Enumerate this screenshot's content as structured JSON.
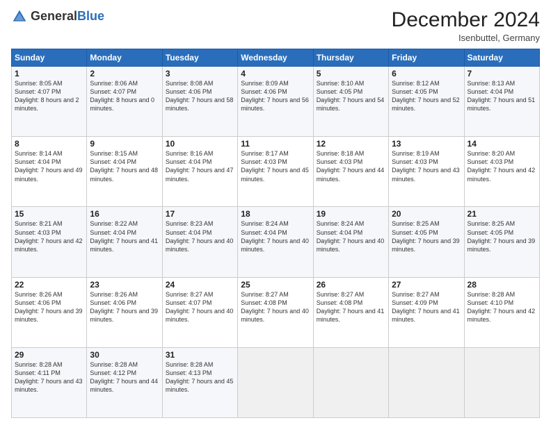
{
  "header": {
    "logo_general": "General",
    "logo_blue": "Blue",
    "title": "December 2024",
    "location": "Isenbuttel, Germany"
  },
  "weekdays": [
    "Sunday",
    "Monday",
    "Tuesday",
    "Wednesday",
    "Thursday",
    "Friday",
    "Saturday"
  ],
  "weeks": [
    [
      {
        "day": "1",
        "sunrise": "Sunrise: 8:05 AM",
        "sunset": "Sunset: 4:07 PM",
        "daylight": "Daylight: 8 hours and 2 minutes."
      },
      {
        "day": "2",
        "sunrise": "Sunrise: 8:06 AM",
        "sunset": "Sunset: 4:07 PM",
        "daylight": "Daylight: 8 hours and 0 minutes."
      },
      {
        "day": "3",
        "sunrise": "Sunrise: 8:08 AM",
        "sunset": "Sunset: 4:06 PM",
        "daylight": "Daylight: 7 hours and 58 minutes."
      },
      {
        "day": "4",
        "sunrise": "Sunrise: 8:09 AM",
        "sunset": "Sunset: 4:06 PM",
        "daylight": "Daylight: 7 hours and 56 minutes."
      },
      {
        "day": "5",
        "sunrise": "Sunrise: 8:10 AM",
        "sunset": "Sunset: 4:05 PM",
        "daylight": "Daylight: 7 hours and 54 minutes."
      },
      {
        "day": "6",
        "sunrise": "Sunrise: 8:12 AM",
        "sunset": "Sunset: 4:05 PM",
        "daylight": "Daylight: 7 hours and 52 minutes."
      },
      {
        "day": "7",
        "sunrise": "Sunrise: 8:13 AM",
        "sunset": "Sunset: 4:04 PM",
        "daylight": "Daylight: 7 hours and 51 minutes."
      }
    ],
    [
      {
        "day": "8",
        "sunrise": "Sunrise: 8:14 AM",
        "sunset": "Sunset: 4:04 PM",
        "daylight": "Daylight: 7 hours and 49 minutes."
      },
      {
        "day": "9",
        "sunrise": "Sunrise: 8:15 AM",
        "sunset": "Sunset: 4:04 PM",
        "daylight": "Daylight: 7 hours and 48 minutes."
      },
      {
        "day": "10",
        "sunrise": "Sunrise: 8:16 AM",
        "sunset": "Sunset: 4:04 PM",
        "daylight": "Daylight: 7 hours and 47 minutes."
      },
      {
        "day": "11",
        "sunrise": "Sunrise: 8:17 AM",
        "sunset": "Sunset: 4:03 PM",
        "daylight": "Daylight: 7 hours and 45 minutes."
      },
      {
        "day": "12",
        "sunrise": "Sunrise: 8:18 AM",
        "sunset": "Sunset: 4:03 PM",
        "daylight": "Daylight: 7 hours and 44 minutes."
      },
      {
        "day": "13",
        "sunrise": "Sunrise: 8:19 AM",
        "sunset": "Sunset: 4:03 PM",
        "daylight": "Daylight: 7 hours and 43 minutes."
      },
      {
        "day": "14",
        "sunrise": "Sunrise: 8:20 AM",
        "sunset": "Sunset: 4:03 PM",
        "daylight": "Daylight: 7 hours and 42 minutes."
      }
    ],
    [
      {
        "day": "15",
        "sunrise": "Sunrise: 8:21 AM",
        "sunset": "Sunset: 4:03 PM",
        "daylight": "Daylight: 7 hours and 42 minutes."
      },
      {
        "day": "16",
        "sunrise": "Sunrise: 8:22 AM",
        "sunset": "Sunset: 4:04 PM",
        "daylight": "Daylight: 7 hours and 41 minutes."
      },
      {
        "day": "17",
        "sunrise": "Sunrise: 8:23 AM",
        "sunset": "Sunset: 4:04 PM",
        "daylight": "Daylight: 7 hours and 40 minutes."
      },
      {
        "day": "18",
        "sunrise": "Sunrise: 8:24 AM",
        "sunset": "Sunset: 4:04 PM",
        "daylight": "Daylight: 7 hours and 40 minutes."
      },
      {
        "day": "19",
        "sunrise": "Sunrise: 8:24 AM",
        "sunset": "Sunset: 4:04 PM",
        "daylight": "Daylight: 7 hours and 40 minutes."
      },
      {
        "day": "20",
        "sunrise": "Sunrise: 8:25 AM",
        "sunset": "Sunset: 4:05 PM",
        "daylight": "Daylight: 7 hours and 39 minutes."
      },
      {
        "day": "21",
        "sunrise": "Sunrise: 8:25 AM",
        "sunset": "Sunset: 4:05 PM",
        "daylight": "Daylight: 7 hours and 39 minutes."
      }
    ],
    [
      {
        "day": "22",
        "sunrise": "Sunrise: 8:26 AM",
        "sunset": "Sunset: 4:06 PM",
        "daylight": "Daylight: 7 hours and 39 minutes."
      },
      {
        "day": "23",
        "sunrise": "Sunrise: 8:26 AM",
        "sunset": "Sunset: 4:06 PM",
        "daylight": "Daylight: 7 hours and 39 minutes."
      },
      {
        "day": "24",
        "sunrise": "Sunrise: 8:27 AM",
        "sunset": "Sunset: 4:07 PM",
        "daylight": "Daylight: 7 hours and 40 minutes."
      },
      {
        "day": "25",
        "sunrise": "Sunrise: 8:27 AM",
        "sunset": "Sunset: 4:08 PM",
        "daylight": "Daylight: 7 hours and 40 minutes."
      },
      {
        "day": "26",
        "sunrise": "Sunrise: 8:27 AM",
        "sunset": "Sunset: 4:08 PM",
        "daylight": "Daylight: 7 hours and 41 minutes."
      },
      {
        "day": "27",
        "sunrise": "Sunrise: 8:27 AM",
        "sunset": "Sunset: 4:09 PM",
        "daylight": "Daylight: 7 hours and 41 minutes."
      },
      {
        "day": "28",
        "sunrise": "Sunrise: 8:28 AM",
        "sunset": "Sunset: 4:10 PM",
        "daylight": "Daylight: 7 hours and 42 minutes."
      }
    ],
    [
      {
        "day": "29",
        "sunrise": "Sunrise: 8:28 AM",
        "sunset": "Sunset: 4:11 PM",
        "daylight": "Daylight: 7 hours and 43 minutes."
      },
      {
        "day": "30",
        "sunrise": "Sunrise: 8:28 AM",
        "sunset": "Sunset: 4:12 PM",
        "daylight": "Daylight: 7 hours and 44 minutes."
      },
      {
        "day": "31",
        "sunrise": "Sunrise: 8:28 AM",
        "sunset": "Sunset: 4:13 PM",
        "daylight": "Daylight: 7 hours and 45 minutes."
      },
      null,
      null,
      null,
      null
    ]
  ]
}
